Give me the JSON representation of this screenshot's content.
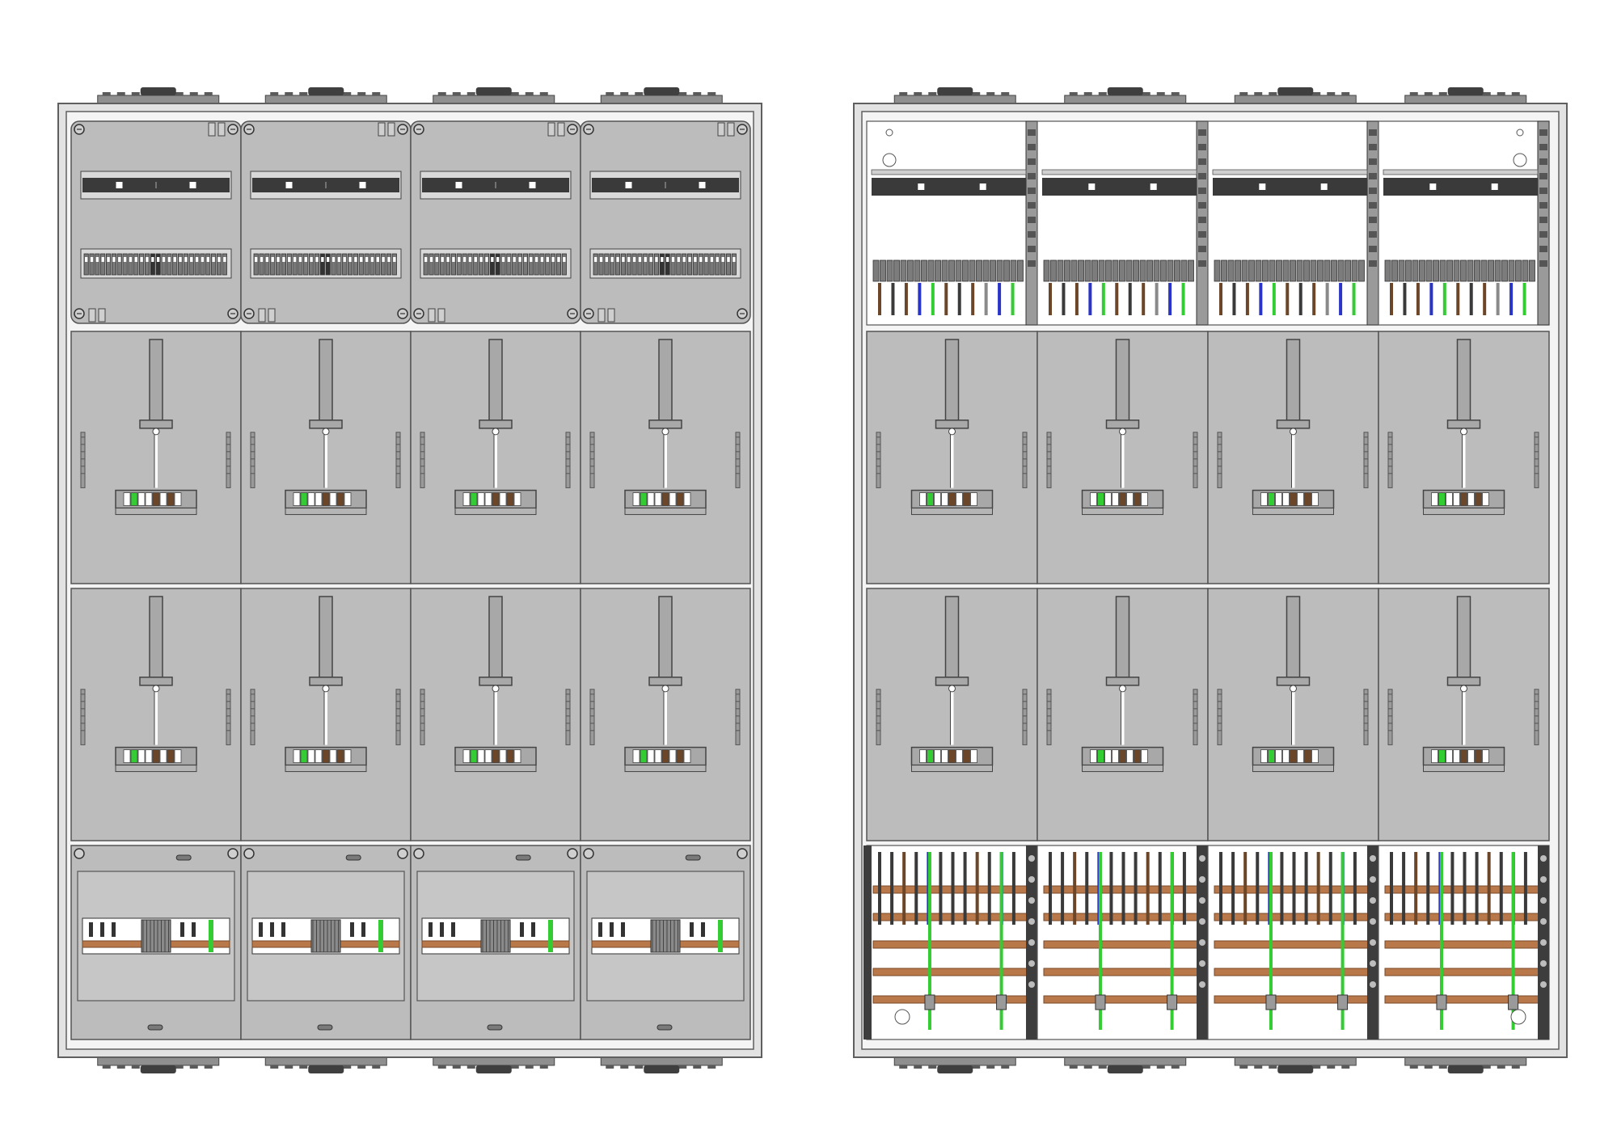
{
  "colors": {
    "background": "#ffffff",
    "frame_outer": "#e2e2e2",
    "frame_stroke": "#5f5f5f",
    "panel_fill": "#bcbcbc",
    "panel_stroke": "#555555",
    "panel_dark": "#444444",
    "busbar_copper": "#b8784a",
    "busbar_copper_dark": "#7a4a28",
    "wire_black": "#3a3a3a",
    "wire_brown": "#6b4628",
    "wire_blue": "#2a35c8",
    "wire_green": "#33cc33",
    "wire_grey": "#8a8a8a",
    "din_rail": "#3a3a3a",
    "white": "#ffffff"
  },
  "cabinets": [
    {
      "variant": "closed-covers",
      "columns": 4
    },
    {
      "variant": "open-wiring",
      "columns": 4
    }
  ]
}
